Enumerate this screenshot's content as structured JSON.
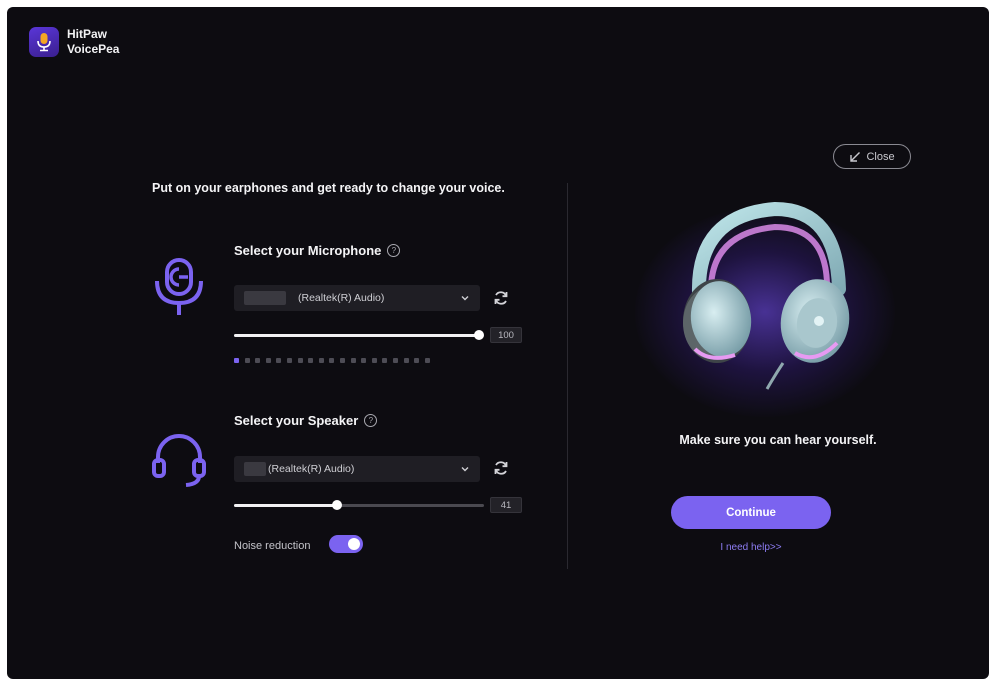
{
  "app": {
    "name_line1": "HitPaw",
    "name_line2": "VoicePea"
  },
  "close_label": "Close",
  "intro_text": "Put on your earphones and get ready to change your voice.",
  "microphone": {
    "title": "Select your Microphone",
    "device": "(Realtek(R) Audio)",
    "volume": 100,
    "volume_text": "100",
    "level_total": 19,
    "level_active": 1
  },
  "speaker": {
    "title": "Select your Speaker",
    "device": "(Realtek(R) Audio)",
    "volume": 41,
    "volume_text": "41"
  },
  "noise_reduction": {
    "label": "Noise reduction",
    "enabled": true
  },
  "hear_text": "Make sure you can hear yourself.",
  "continue_label": "Continue",
  "help_link": "I need help>>",
  "colors": {
    "accent": "#7b63f0",
    "background": "#0d0c11",
    "panel": "#1f1e24"
  },
  "icons": [
    "microphone-icon",
    "headset-icon",
    "help-icon",
    "refresh-icon",
    "chevron-down-icon",
    "shrink-arrow-icon",
    "logo-icon"
  ]
}
